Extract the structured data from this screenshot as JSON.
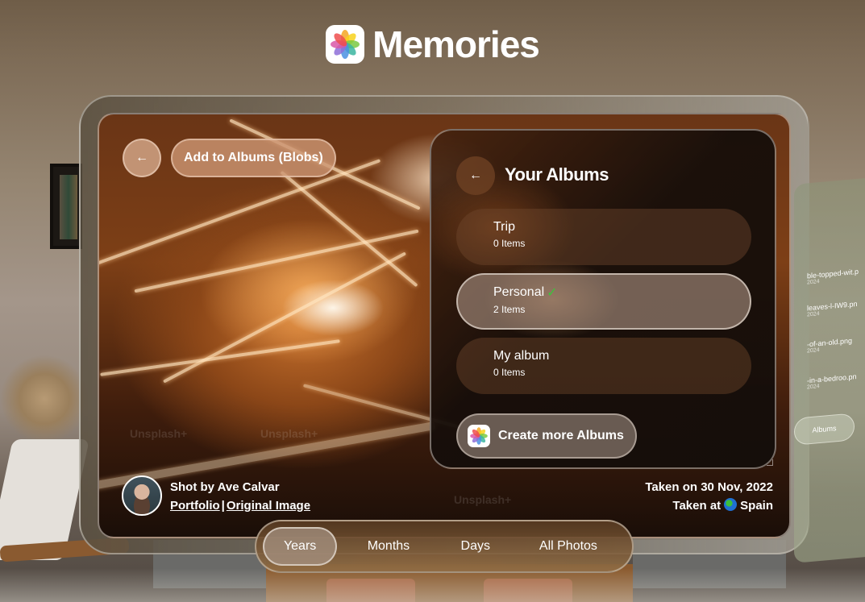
{
  "header": {
    "app_icon": "photos-flower-icon",
    "title": "Memories"
  },
  "photo_view": {
    "back_icon": "arrow-left-icon",
    "add_to_albums_label": "Add to Albums (Blobs)",
    "watermark_text": "Unsplash+",
    "credit": {
      "shot_by": "Shot by Ave Calvar",
      "portfolio_label": "Portfolio",
      "separator": "|",
      "original_image_label": "Original Image"
    },
    "taken": {
      "date_text": "Taken on 30 Nov, 2022",
      "location_prefix": "Taken at",
      "location_icon": "globe-icon",
      "location": "Spain"
    }
  },
  "albums_panel": {
    "back_icon": "arrow-left-icon",
    "title": "Your Albums",
    "albums": [
      {
        "name": "Trip",
        "count": "0 Items",
        "selected": false
      },
      {
        "name": "Personal",
        "count": "2 Items",
        "selected": true,
        "check_icon": "✓"
      },
      {
        "name": "My album",
        "count": "0 Items",
        "selected": false
      }
    ],
    "create_label": "Create more Albums"
  },
  "side_panel_peek": {
    "rows": [
      {
        "name": "ble-topped-wit.p",
        "year": "2024"
      },
      {
        "name": "leaves-l-IW9.pn",
        "year": "2024"
      },
      {
        "name": "-of-an-old.png",
        "year": "2024"
      },
      {
        "name": "-in-a-bedroo.pn",
        "year": "2024"
      }
    ],
    "button_label": "Albums"
  },
  "tabbar": {
    "tabs": [
      {
        "label": "Years",
        "active": true
      },
      {
        "label": "Months",
        "active": false
      },
      {
        "label": "Days",
        "active": false
      },
      {
        "label": "All Photos",
        "active": false
      }
    ]
  },
  "colors": {
    "check_green": "#3bc43b",
    "text": "#ffffff"
  }
}
